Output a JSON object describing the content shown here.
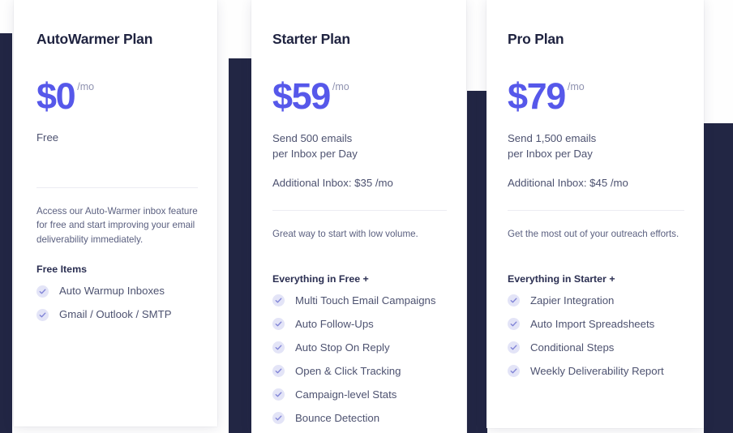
{
  "theme": {
    "accent": "#5658ea",
    "navy": "#222644",
    "page_bg": "#fefefe",
    "card_bg": "#ffffff",
    "body_text": "#4d5270",
    "heading_text": "#1f2340",
    "check_bg": "#e3e4f7",
    "check_mark": "#7f82d6",
    "divider": "#ececf2"
  },
  "plans": [
    {
      "id": "autowarmer",
      "title": "AutoWarmer Plan",
      "price_amount": "$0",
      "price_period": "/mo",
      "free_label": "Free",
      "quota_lines": [],
      "addon": "",
      "tagline": "Access our Auto-Warmer inbox feature for free and start improving your email deliverability immediately.",
      "features_heading": "Free Items",
      "features": [
        {
          "icon": "check-circle-icon",
          "label": "Auto Warmup Inboxes"
        },
        {
          "icon": "check-circle-icon",
          "label": "Gmail / Outlook / SMTP"
        }
      ]
    },
    {
      "id": "starter",
      "title": "Starter Plan",
      "price_amount": "$59",
      "price_period": "/mo",
      "free_label": "",
      "quota_lines": [
        "Send 500 emails",
        "per Inbox per Day"
      ],
      "addon": "Additional Inbox: $35 /mo",
      "tagline": "Great way to start with low volume.",
      "features_heading": "Everything in Free +",
      "features": [
        {
          "icon": "check-circle-icon",
          "label": "Multi Touch Email Campaigns"
        },
        {
          "icon": "check-circle-icon",
          "label": "Auto Follow-Ups"
        },
        {
          "icon": "check-circle-icon",
          "label": "Auto Stop On Reply"
        },
        {
          "icon": "check-circle-icon",
          "label": "Open & Click Tracking"
        },
        {
          "icon": "check-circle-icon",
          "label": "Campaign-level Stats"
        },
        {
          "icon": "check-circle-icon",
          "label": "Bounce Detection"
        }
      ]
    },
    {
      "id": "pro",
      "title": "Pro Plan",
      "price_amount": "$79",
      "price_period": "/mo",
      "free_label": "",
      "quota_lines": [
        "Send 1,500 emails",
        "per Inbox per Day"
      ],
      "addon": "Additional Inbox: $45 /mo",
      "tagline": "Get the most out of your outreach efforts.",
      "features_heading": "Everything in Starter +",
      "features": [
        {
          "icon": "check-circle-icon",
          "label": "Zapier Integration"
        },
        {
          "icon": "check-circle-icon",
          "label": "Auto Import Spreadsheets"
        },
        {
          "icon": "check-circle-icon",
          "label": "Conditional Steps"
        },
        {
          "icon": "check-circle-icon",
          "label": "Weekly Deliverability Report"
        }
      ]
    }
  ]
}
